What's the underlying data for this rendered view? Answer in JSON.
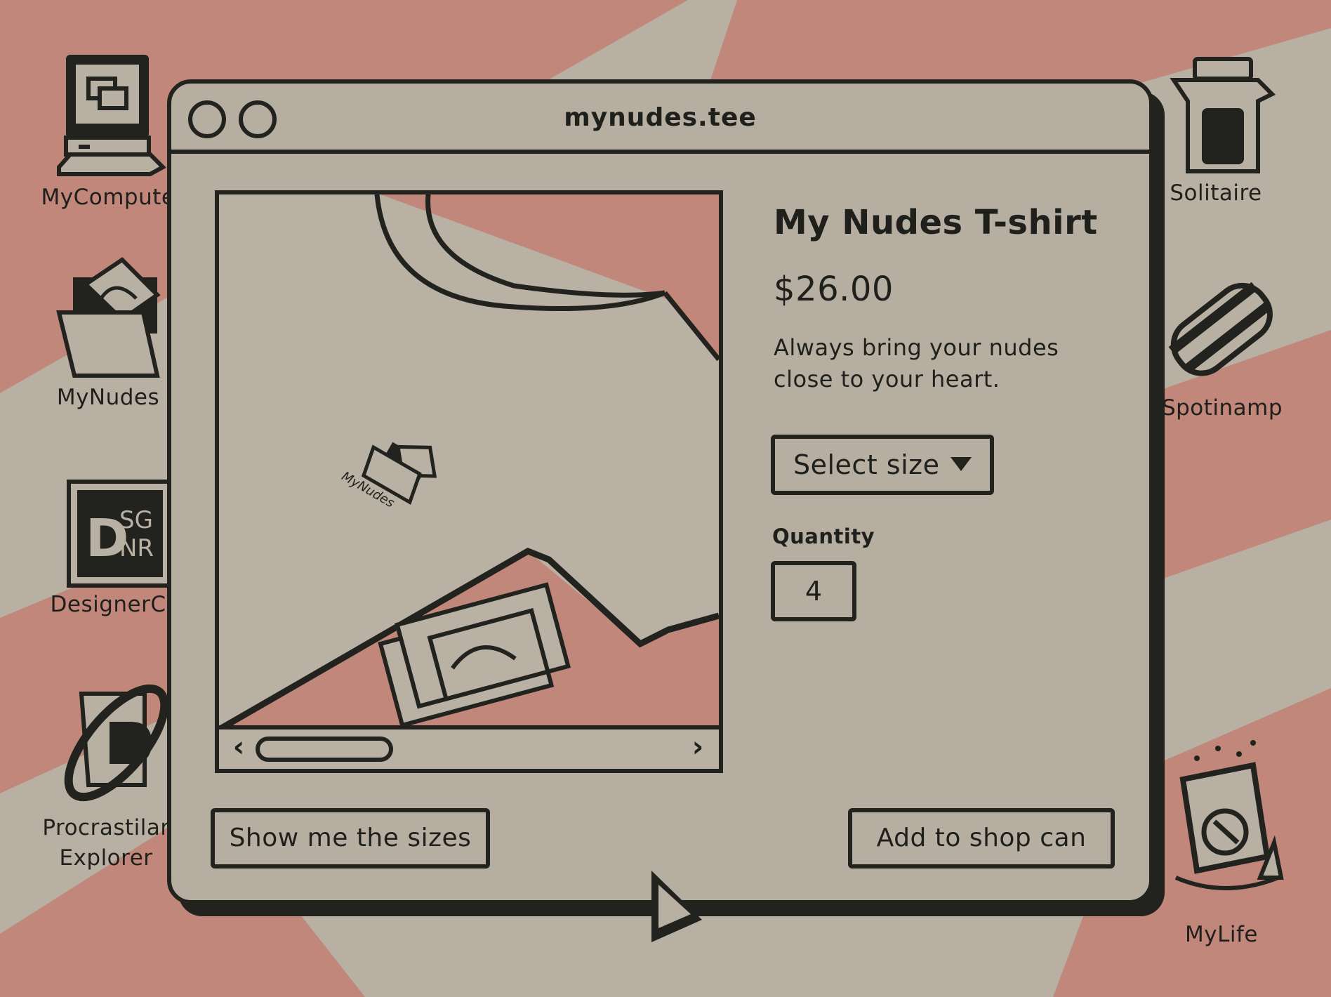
{
  "desktop": {
    "icons_left": [
      {
        "label": "MyCompute",
        "icon": "computer-icon"
      },
      {
        "label": "MyNudes",
        "icon": "folder-icon"
      },
      {
        "label": "DesignerC",
        "icon": "dsgnr-icon"
      },
      {
        "label_line1": "Procrastilar",
        "label_line2": "Explorer",
        "icon": "browser-icon"
      }
    ],
    "icons_right": [
      {
        "label": "Solitaire",
        "icon": "cards-icon"
      },
      {
        "label": "Spotinamp",
        "icon": "music-icon"
      },
      {
        "label": "MyLife",
        "icon": "trash-icon"
      }
    ],
    "dsgnr_text": {
      "big": "D",
      "top": "SG",
      "bottom": "NR"
    }
  },
  "window": {
    "title": "mynudes.tee"
  },
  "gallery": {
    "print_label": "MyNudes",
    "prev_label": "‹",
    "next_label": "›"
  },
  "product": {
    "title": "My Nudes T-shirt",
    "price": "$26.00",
    "description": "Always bring your nudes close to your heart.",
    "size_select": {
      "selected": "Select size"
    },
    "quantity_label": "Quantity",
    "quantity_value": "4"
  },
  "actions": {
    "sizes_label": "Show me the sizes",
    "cart_label": "Add to shop can"
  },
  "colors": {
    "background": "#b8b0a3",
    "accent": "#c0877a",
    "ink": "#22221f",
    "window": "#b5aea1"
  }
}
